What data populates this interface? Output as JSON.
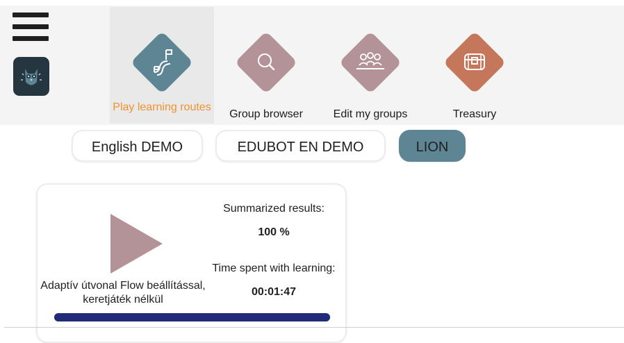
{
  "nav": {
    "items": [
      {
        "label": "Play learning routes",
        "icon": "learning-route-icon",
        "color": "#5d8594",
        "active": true
      },
      {
        "label": "Group browser",
        "icon": "search-icon",
        "color": "#b39397",
        "active": false
      },
      {
        "label": "Edit my groups",
        "icon": "group-icon",
        "color": "#b39397",
        "active": false
      },
      {
        "label": "Treasury",
        "icon": "treasure-chest-icon",
        "color": "#c4775a",
        "active": false
      }
    ],
    "active_label_color": "#f0922e"
  },
  "groups": {
    "items": [
      {
        "label": "English DEMO",
        "selected": false
      },
      {
        "label": "EDUBOT EN DEMO",
        "selected": false
      },
      {
        "label": "LION",
        "selected": true
      }
    ]
  },
  "route_card": {
    "title": "Adaptív útvonal Flow beállítással, keretjáték nélkül",
    "summarized_label": "Summarized results:",
    "summarized_value": "100 %",
    "time_label": "Time spent with learning:",
    "time_value": "00:01:47",
    "progress_percent": 100,
    "play_color": "#b39397",
    "progress_color": "#222b78"
  }
}
